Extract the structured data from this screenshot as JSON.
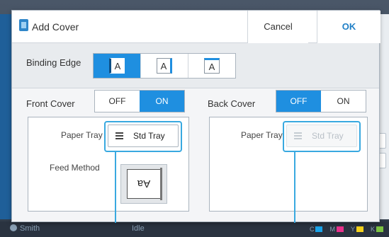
{
  "dialog": {
    "title": "Add Cover",
    "cancel_label": "Cancel",
    "ok_label": "OK"
  },
  "binding_edge": {
    "label": "Binding Edge",
    "options": [
      {
        "glyph": "A",
        "edge": "left",
        "selected": true
      },
      {
        "glyph": "A",
        "edge": "right",
        "selected": false
      },
      {
        "glyph": "A",
        "edge": "top",
        "selected": false
      }
    ]
  },
  "front_cover": {
    "title": "Front Cover",
    "off_label": "OFF",
    "on_label": "ON",
    "selected": "ON",
    "paper_tray_label": "Paper Tray",
    "paper_tray_value": "Std Tray",
    "feed_method_label": "Feed Method",
    "feed_glyph": "Aa"
  },
  "back_cover": {
    "title": "Back Cover",
    "off_label": "OFF",
    "on_label": "ON",
    "selected": "OFF",
    "paper_tray_label": "Paper Tray",
    "paper_tray_value": "Std Tray",
    "paper_tray_enabled": false
  },
  "background": {
    "user": "Smith",
    "status": "Idle",
    "ink_labels": [
      "C",
      "M",
      "Y",
      "K"
    ]
  },
  "colors": {
    "accent": "#1f8fe0",
    "callout": "#39a9e0",
    "ok_text": "#1f7fc6"
  }
}
